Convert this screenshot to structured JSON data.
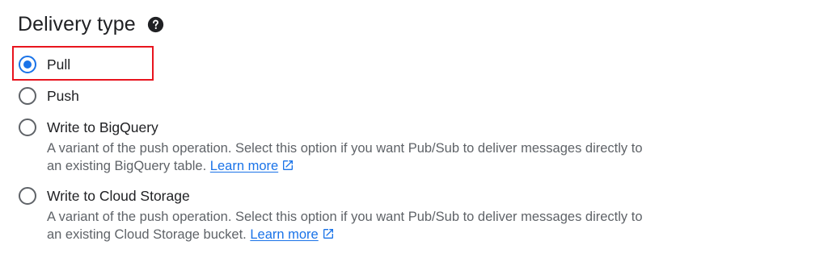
{
  "section": {
    "title": "Delivery type",
    "help_icon": "help-circle-icon"
  },
  "options": [
    {
      "label": "Pull",
      "selected": true
    },
    {
      "label": "Push",
      "selected": false
    },
    {
      "label": "Write to BigQuery",
      "selected": false,
      "description": "A variant of the push operation. Select this option if you want Pub/Sub to deliver messages directly to an existing BigQuery table.",
      "link_text": "Learn more",
      "link_icon": "open-in-new-icon"
    },
    {
      "label": "Write to Cloud Storage",
      "selected": false,
      "description": "A variant of the push operation. Select this option if you want Pub/Sub to deliver messages directly to an existing Cloud Storage bucket.",
      "link_text": "Learn more",
      "link_icon": "open-in-new-icon"
    }
  ],
  "colors": {
    "accent": "#1a73e8",
    "radio_unchecked": "#5f6368",
    "highlight": "#e8141e",
    "text": "#202124",
    "secondary_text": "#5f6368"
  }
}
